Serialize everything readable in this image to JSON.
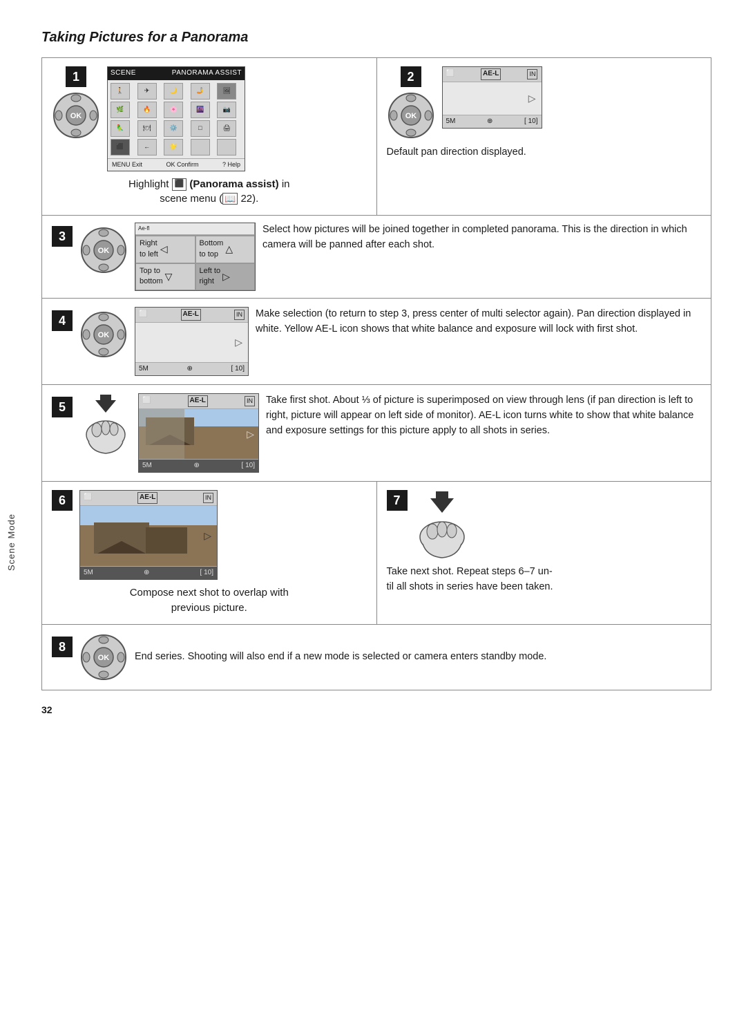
{
  "page": {
    "title": "Taking Pictures for a Panorama",
    "page_number": "32",
    "sidebar_label": "Scene Mode"
  },
  "steps": {
    "step1": {
      "number": "1",
      "text_line1": "Highlight",
      "text_bold": "(Panorama assist)",
      "text_line2": "in",
      "text_line3": "scene menu (",
      "ref": "22",
      "ref_suffix": ").",
      "menu_title_left": "SCENE",
      "menu_title_right": "PANORAMA ASSIST",
      "menu_bottom_left": "MENU Exit",
      "menu_bottom_mid": "OK Confirm",
      "menu_bottom_right": "? Help"
    },
    "step2": {
      "number": "2",
      "desc": "Default pan direction displayed.",
      "screen_5m": "5M",
      "screen_10": "[ 10]",
      "ae_l": "AE-L",
      "in": "IN"
    },
    "step3": {
      "number": "3",
      "pan_options": [
        {
          "label": "Right to left",
          "arrow": "◁"
        },
        {
          "label": "Bottom to top",
          "arrow": "△"
        },
        {
          "label": "Top to bottom",
          "arrow": "▽"
        },
        {
          "label": "Left to right",
          "arrow": "▷"
        }
      ],
      "desc": "Select how pictures will be joined together in completed panorama. This is the direction in which camera will be panned after each shot."
    },
    "step4": {
      "number": "4",
      "ae_l": "AE-L",
      "in": "IN",
      "screen_5m": "5M",
      "screen_10": "[ 10]",
      "desc": "Make selection (to return to step 3, press center of multi selector again). Pan direction displayed in white. Yellow AE-L icon shows that white balance and exposure will lock with first shot."
    },
    "step5": {
      "number": "5",
      "ae_l": "AE-L",
      "in": "IN",
      "screen_5m": "5M",
      "screen_10": "[ 10]",
      "desc": "Take first shot. About ⅓ of picture is superimposed on view through lens (if pan direction is left to right, picture will appear on left side of monitor). AE-L icon turns white to show that white balance and exposure settings for this picture apply to all shots in series."
    },
    "step6": {
      "number": "6",
      "ae_l": "AE-L",
      "in": "IN",
      "screen_5m": "5M",
      "screen_10": "[ 10]",
      "desc1": "Compose next shot to overlap with",
      "desc2": "previous picture."
    },
    "step7": {
      "number": "7",
      "desc1": "Take next shot. Repeat steps 6–7 un-",
      "desc2": "til all shots in series have been taken."
    },
    "step8": {
      "number": "8",
      "desc": "End series. Shooting will also end if a new mode is selected or camera enters standby mode."
    }
  }
}
